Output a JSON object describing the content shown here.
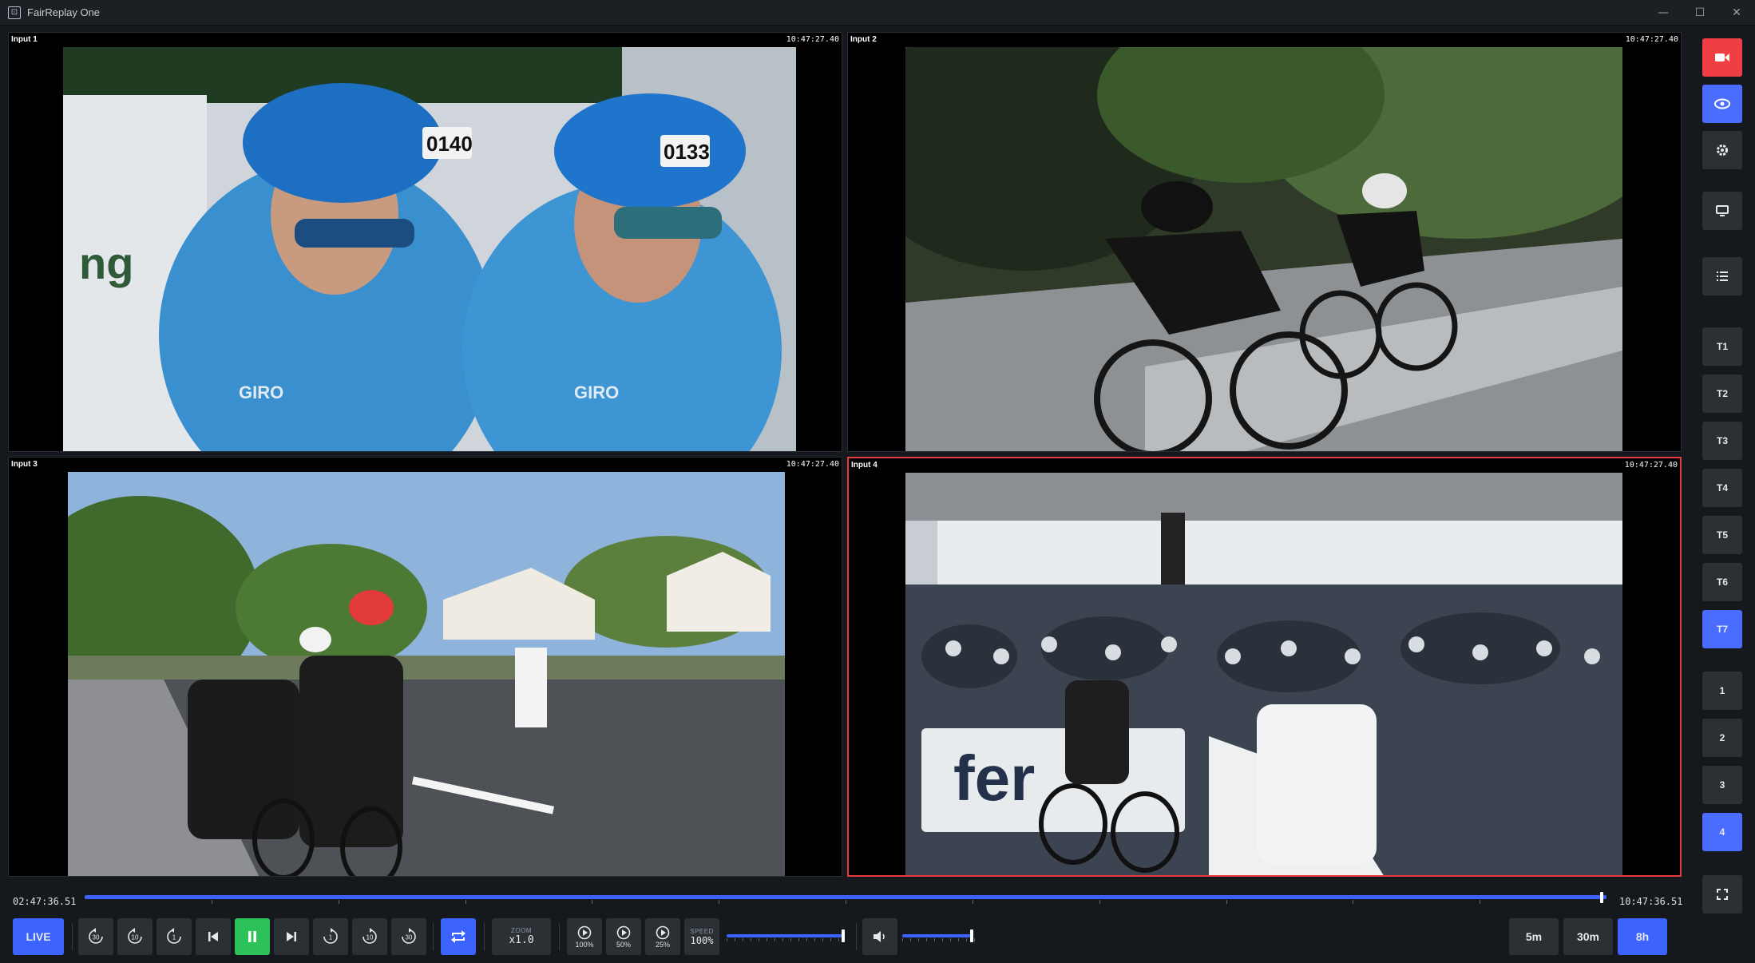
{
  "window": {
    "title": "FairReplay One",
    "icon_glyph": "⊡",
    "minimize": "—",
    "maximize": "☐",
    "close": "✕"
  },
  "panels": [
    {
      "label": "Input 1",
      "time": "10:47:27.40"
    },
    {
      "label": "Input 2",
      "time": "10:47:27.40"
    },
    {
      "label": "Input 3",
      "time": "10:47:27.40"
    },
    {
      "label": "Input 4",
      "time": "10:47:27.40",
      "active": true
    }
  ],
  "sidebar": {
    "record_icon": "video-camera-icon",
    "view_icon": "eye-icon",
    "settings_icon": "gear-icon",
    "monitor_icon": "monitor-icon",
    "list_icon": "list-icon",
    "tracks": [
      "T1",
      "T2",
      "T3",
      "T4",
      "T5",
      "T6",
      "T7"
    ],
    "active_track": "T7",
    "inputs": [
      "1",
      "2",
      "3",
      "4"
    ],
    "active_input": "4",
    "fullscreen_icon": "fullscreen-icon"
  },
  "timeline": {
    "start": "02:47:36.51",
    "end": "10:47:36.51",
    "position": 0.997
  },
  "controls": {
    "live_label": "LIVE",
    "rewind_30": "30",
    "rewind_10": "10",
    "rewind_1": "1",
    "forward_1": "1",
    "forward_10": "10",
    "forward_30": "30",
    "zoom_caption": "ZOOM",
    "zoom_value": "x1.0",
    "speed_100": "100%",
    "speed_50": "50%",
    "speed_25": "25%",
    "speed_caption": "SPEED",
    "speed_value": "100%",
    "speed_level": 1.0,
    "volume_level": 0.93,
    "ranges": [
      "5m",
      "30m",
      "8h"
    ],
    "active_range": "8h"
  },
  "colors": {
    "accent": "#3d63ff",
    "record": "#ef3e44",
    "play": "#2cc159",
    "active_border": "#e63a3e"
  }
}
